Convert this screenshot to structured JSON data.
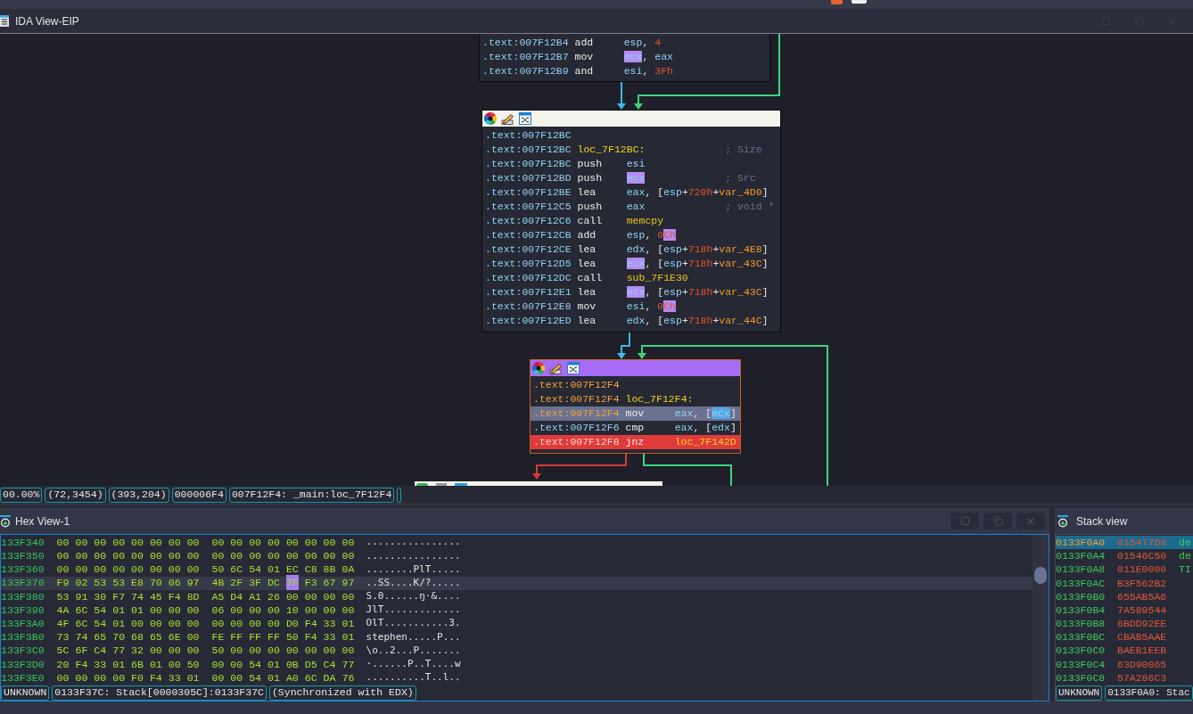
{
  "ida_view": {
    "title": "IDA View-EIP",
    "blocks": [
      {
        "selected": false,
        "toolbar": false,
        "lines": [
          {
            "address": ".text:007F12B4",
            "mnemonic": "add",
            "operands": [
              {
                "kind": "reg",
                "text": "esp"
              },
              {
                "kind": "punct",
                "text": ", "
              },
              {
                "kind": "num",
                "text": "4"
              }
            ]
          },
          {
            "address": ".text:007F12B7",
            "mnemonic": "mov",
            "operands": [
              {
                "kind": "reg",
                "text": "ecx",
                "highlighted": true
              },
              {
                "kind": "punct",
                "text": ", "
              },
              {
                "kind": "reg",
                "text": "eax"
              }
            ]
          },
          {
            "address": ".text:007F12B9",
            "mnemonic": "and",
            "operands": [
              {
                "kind": "reg",
                "text": "esi"
              },
              {
                "kind": "punct",
                "text": ", "
              },
              {
                "kind": "num",
                "text": "3Fh"
              }
            ]
          }
        ]
      },
      {
        "selected": false,
        "toolbar": true,
        "lines": [
          {
            "address": ".text:007F12BC"
          },
          {
            "address": ".text:007F12BC",
            "label": "loc_7F12BC:",
            "comment": "; Size"
          },
          {
            "address": ".text:007F12BC",
            "mnemonic": "push",
            "operands": [
              {
                "kind": "reg",
                "text": "esi"
              }
            ]
          },
          {
            "address": ".text:007F12BD",
            "mnemonic": "push",
            "operands": [
              {
                "kind": "reg",
                "text": "ecx",
                "highlighted": true
              }
            ],
            "comment": "; Src"
          },
          {
            "address": ".text:007F12BE",
            "mnemonic": "lea",
            "operands": [
              {
                "kind": "reg",
                "text": "eax"
              },
              {
                "kind": "punct",
                "text": ", ["
              },
              {
                "kind": "reg",
                "text": "esp"
              },
              {
                "kind": "punct",
                "text": "+"
              },
              {
                "kind": "num",
                "text": "720h"
              },
              {
                "kind": "punct",
                "text": "+"
              },
              {
                "kind": "var",
                "text": "var_4D0"
              },
              {
                "kind": "punct",
                "text": "]"
              }
            ]
          },
          {
            "address": ".text:007F12C5",
            "mnemonic": "push",
            "operands": [
              {
                "kind": "reg",
                "text": "eax"
              }
            ],
            "comment": "; void *"
          },
          {
            "address": ".text:007F12C6",
            "mnemonic": "call",
            "operands": [
              {
                "kind": "func",
                "text": "memcpy"
              }
            ]
          },
          {
            "address": ".text:007F12CB",
            "mnemonic": "add",
            "operands": [
              {
                "kind": "reg",
                "text": "esp"
              },
              {
                "kind": "punct",
                "text": ", "
              },
              {
                "kind": "num",
                "text": "0"
              },
              {
                "kind": "num",
                "text": "Ch",
                "highlighted": true
              }
            ]
          },
          {
            "address": ".text:007F12CE",
            "mnemonic": "lea",
            "operands": [
              {
                "kind": "reg",
                "text": "edx"
              },
              {
                "kind": "punct",
                "text": ", ["
              },
              {
                "kind": "reg",
                "text": "esp"
              },
              {
                "kind": "punct",
                "text": "+"
              },
              {
                "kind": "num",
                "text": "718h"
              },
              {
                "kind": "punct",
                "text": "+"
              },
              {
                "kind": "var",
                "text": "var_4E8"
              },
              {
                "kind": "punct",
                "text": "]"
              }
            ]
          },
          {
            "address": ".text:007F12D5",
            "mnemonic": "lea",
            "operands": [
              {
                "kind": "reg",
                "text": "ecx",
                "highlighted": true
              },
              {
                "kind": "punct",
                "text": ", ["
              },
              {
                "kind": "reg",
                "text": "esp"
              },
              {
                "kind": "punct",
                "text": "+"
              },
              {
                "kind": "num",
                "text": "718h"
              },
              {
                "kind": "punct",
                "text": "+"
              },
              {
                "kind": "var",
                "text": "var_43C"
              },
              {
                "kind": "punct",
                "text": "]"
              }
            ]
          },
          {
            "address": ".text:007F12DC",
            "mnemonic": "call",
            "operands": [
              {
                "kind": "func",
                "text": "sub_7F1E30"
              }
            ]
          },
          {
            "address": ".text:007F12E1",
            "mnemonic": "lea",
            "operands": [
              {
                "kind": "reg",
                "text": "ecx",
                "highlighted": true
              },
              {
                "kind": "punct",
                "text": ", ["
              },
              {
                "kind": "reg",
                "text": "esp"
              },
              {
                "kind": "punct",
                "text": "+"
              },
              {
                "kind": "num",
                "text": "718h"
              },
              {
                "kind": "punct",
                "text": "+"
              },
              {
                "kind": "var",
                "text": "var_43C"
              },
              {
                "kind": "punct",
                "text": "]"
              }
            ]
          },
          {
            "address": ".text:007F12E8",
            "mnemonic": "mov",
            "operands": [
              {
                "kind": "reg",
                "text": "esi"
              },
              {
                "kind": "punct",
                "text": ", "
              },
              {
                "kind": "num",
                "text": "0"
              },
              {
                "kind": "num",
                "text": "Ch",
                "highlighted": true
              }
            ]
          },
          {
            "address": ".text:007F12ED",
            "mnemonic": "lea",
            "operands": [
              {
                "kind": "reg",
                "text": "edx"
              },
              {
                "kind": "punct",
                "text": ", ["
              },
              {
                "kind": "reg",
                "text": "esp"
              },
              {
                "kind": "punct",
                "text": "+"
              },
              {
                "kind": "num",
                "text": "718h"
              },
              {
                "kind": "punct",
                "text": "+"
              },
              {
                "kind": "var",
                "text": "var_44C"
              },
              {
                "kind": "punct",
                "text": "]"
              }
            ]
          }
        ]
      },
      {
        "selected": true,
        "toolbar": true,
        "lines": [
          {
            "address": ".text:007F12F4",
            "current": true,
            "selected": false,
            "breakpoint": false
          },
          {
            "address": ".text:007F12F4",
            "label": "loc_7F12F4:",
            "current": true,
            "selected": false,
            "breakpoint": false
          },
          {
            "address": ".text:007F12F4",
            "mnemonic": "mov",
            "operands": [
              {
                "kind": "reg",
                "text": "eax"
              },
              {
                "kind": "punct",
                "text": ", ["
              },
              {
                "kind": "reg",
                "text": "ecx",
                "highlighted": true
              },
              {
                "kind": "punct",
                "text": "]"
              }
            ],
            "current": true,
            "selected": true,
            "breakpoint": false
          },
          {
            "address": ".text:007F12F6",
            "mnemonic": "cmp",
            "operands": [
              {
                "kind": "reg",
                "text": "eax"
              },
              {
                "kind": "punct",
                "text": ", ["
              },
              {
                "kind": "reg",
                "text": "edx"
              },
              {
                "kind": "punct",
                "text": "]"
              }
            ],
            "current": false,
            "selected": false,
            "breakpoint": false
          },
          {
            "address": ".text:007F12F8",
            "mnemonic": "jnz",
            "operands": [
              {
                "kind": "label",
                "text": "loc_7F142D"
              }
            ],
            "current": false,
            "selected": false,
            "breakpoint": true
          }
        ]
      },
      {
        "selected": false,
        "toolbar": true
      }
    ],
    "edges": [
      {
        "color": "#3bb9ea"
      },
      {
        "color": "#3ed47f"
      },
      {
        "color": "#3bb9ea"
      },
      {
        "color": "#3ed47f"
      },
      {
        "color": "#d43a3a"
      },
      {
        "color": "#3ed47f"
      }
    ]
  },
  "status_bar": [
    "00.00%",
    "(72,3454)",
    "(393,204)",
    "000006F4",
    "007F12F4: _main:loc_7F12F4"
  ],
  "hex_view": {
    "title": "Hex View-1",
    "rows": [
      {
        "address": "133F340",
        "bytes": [
          "00",
          "00",
          "00",
          "00",
          "00",
          "00",
          "00",
          "00",
          "00",
          "00",
          "00",
          "00",
          "00",
          "00",
          "00",
          "00"
        ],
        "ascii": "................",
        "selected": false
      },
      {
        "address": "133F350",
        "bytes": [
          "00",
          "00",
          "00",
          "00",
          "00",
          "00",
          "00",
          "00",
          "00",
          "00",
          "00",
          "00",
          "00",
          "00",
          "00",
          "00"
        ],
        "ascii": "................",
        "selected": false
      },
      {
        "address": "133F360",
        "bytes": [
          "00",
          "00",
          "00",
          "00",
          "00",
          "00",
          "00",
          "00",
          "50",
          "6C",
          "54",
          "01",
          "EC",
          "C8",
          "8B",
          "0A"
        ],
        "ascii": "........PlT.....",
        "selected": false
      },
      {
        "address": "133F370",
        "bytes": [
          "F9",
          "02",
          "53",
          "53",
          "E8",
          "70",
          "06",
          "97",
          "4B",
          "2F",
          "3F",
          "DC",
          {
            "text": "7F",
            "cursor": true
          },
          "F3",
          "67",
          "97"
        ],
        "ascii": "..SS....K/?.....",
        "selected": true
      },
      {
        "address": "133F380",
        "bytes": [
          "53",
          "91",
          "30",
          "F7",
          "74",
          "45",
          "F4",
          "8D",
          "A5",
          "D4",
          "A1",
          "26",
          "00",
          "00",
          "00",
          "00"
        ],
        "ascii": "S.0......ŋ·&....",
        "selected": false
      },
      {
        "address": "133F390",
        "bytes": [
          "4A",
          "6C",
          "54",
          "01",
          "01",
          "00",
          "00",
          "00",
          "06",
          "00",
          "00",
          "00",
          "10",
          "00",
          "00",
          "00"
        ],
        "ascii": "JlT.............",
        "selected": false
      },
      {
        "address": "133F3A0",
        "bytes": [
          "4F",
          "6C",
          "54",
          "01",
          "00",
          "00",
          "00",
          "00",
          "00",
          "00",
          "00",
          "00",
          "D0",
          "F4",
          "33",
          "01"
        ],
        "ascii": "OlT...........3.",
        "selected": false
      },
      {
        "address": "133F3B0",
        "bytes": [
          "73",
          "74",
          "65",
          "70",
          "68",
          "65",
          "6E",
          "00",
          "FE",
          "FF",
          "FF",
          "FF",
          "50",
          "F4",
          "33",
          "01"
        ],
        "ascii": "stephen.....P...",
        "selected": false
      },
      {
        "address": "133F3C0",
        "bytes": [
          "5C",
          "6F",
          "C4",
          "77",
          "32",
          "00",
          "00",
          "00",
          "50",
          "00",
          "00",
          "00",
          "00",
          "00",
          "00",
          "00"
        ],
        "ascii": "\\o..2...P.......",
        "selected": false
      },
      {
        "address": "133F3D0",
        "bytes": [
          "20",
          "F4",
          "33",
          "01",
          "6B",
          "01",
          "00",
          "50",
          "00",
          "00",
          "54",
          "01",
          "0B",
          "D5",
          "C4",
          "77"
        ],
        "ascii": "·......P..T....w",
        "selected": false
      },
      {
        "address": "133F3E0",
        "bytes": [
          "00",
          "00",
          "00",
          "00",
          "F0",
          "F4",
          "33",
          "01",
          "00",
          "00",
          "54",
          "01",
          "A0",
          "6C",
          "DA",
          "76"
        ],
        "ascii": "..........T..l..",
        "selected": false
      }
    ],
    "status": [
      "UNKNOWN",
      "0133F37C: Stack[0000305C]:0133F37C",
      "(Synchronized with EDX)"
    ]
  },
  "stack_view": {
    "title": "Stack view",
    "rows": [
      {
        "address": "0133F0A0",
        "value": "015477D0",
        "column_3": "de",
        "selected": true
      },
      {
        "address": "0133F0A4",
        "value": "01546C50",
        "column_3": "de",
        "selected": false
      },
      {
        "address": "0133F0A8",
        "value": "011E0000",
        "column_3": "TI",
        "selected": false
      },
      {
        "address": "0133F0AC",
        "value": "B3F562B2",
        "selected": false
      },
      {
        "address": "0133F0B0",
        "value": "655AB5A6",
        "selected": false
      },
      {
        "address": "0133F0B4",
        "value": "7A589544",
        "selected": false
      },
      {
        "address": "0133F0B8",
        "value": "6BDD92EE",
        "selected": false
      },
      {
        "address": "0133F0BC",
        "value": "CBAB5AAE",
        "selected": false
      },
      {
        "address": "0133F0C0",
        "value": "BAEB1EEB",
        "selected": false
      },
      {
        "address": "0133F0C4",
        "value": "63D90065",
        "selected": false
      },
      {
        "address": "0133F0C8",
        "value": "57A286C3",
        "selected": false
      }
    ],
    "status": [
      "UNKNOWN",
      "0133F0A0: Stac"
    ]
  }
}
